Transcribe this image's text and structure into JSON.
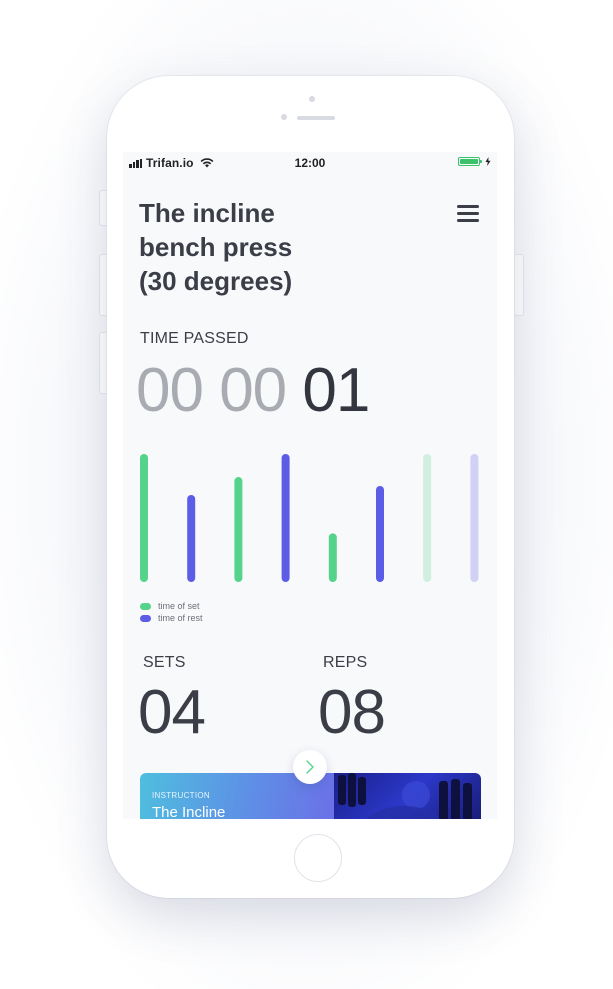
{
  "status_bar": {
    "carrier": "Trifan.io",
    "time": "12:00"
  },
  "exercise": {
    "title_lines": [
      "The incline",
      "bench press",
      "(30 degrees)"
    ]
  },
  "timer": {
    "label": "TIME PASSED",
    "hours": "00",
    "minutes": "00",
    "seconds": "01"
  },
  "chart_data": {
    "type": "bar",
    "series": [
      {
        "name": "time of set",
        "color": "#56d38a",
        "values": [
          100,
          null,
          82,
          null,
          38,
          null,
          100,
          null
        ]
      },
      {
        "name": "time of rest",
        "color": "#5c5ce6",
        "values": [
          null,
          68,
          null,
          100,
          null,
          75,
          null,
          100
        ]
      }
    ],
    "bar_opacity": [
      1,
      1,
      1,
      1,
      1,
      1,
      0.25,
      0.25
    ],
    "ylim": [
      0,
      100
    ]
  },
  "stats": {
    "sets_label": "SETS",
    "sets_value": "04",
    "reps_label": "REPS",
    "reps_value": "08"
  },
  "instruction_card": {
    "kicker": "INSTRUCTION",
    "title": "The Incline"
  },
  "colors": {
    "set": "#56d38a",
    "rest": "#5c5ce6",
    "text": "#3b3d47"
  },
  "icons": {
    "menu": "hamburger-icon",
    "next": "chevron-right-icon",
    "wifi": "wifi-icon",
    "battery": "battery-icon",
    "signal": "signal-icon"
  }
}
